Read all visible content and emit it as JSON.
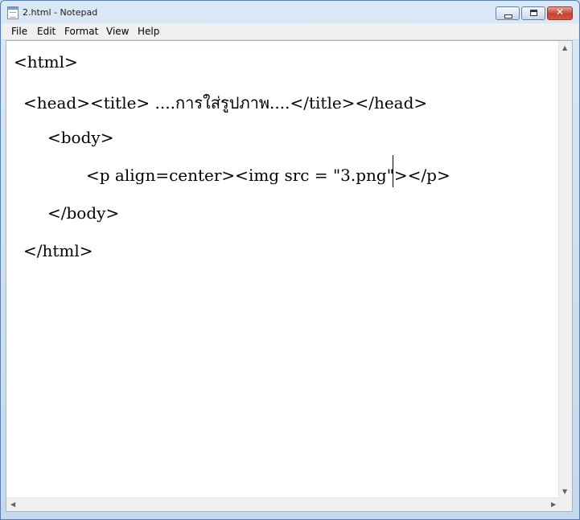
{
  "window": {
    "title": "2.html - Notepad"
  },
  "menu": {
    "items": [
      "File",
      "Edit",
      "Format",
      "View",
      "Help"
    ]
  },
  "editor": {
    "lines": [
      "<html>",
      "<head><title> ....การใส่รูปภาพ....</title></head>",
      "<body>",
      "<p align=center><img src = \"3.png\"></p>",
      "</body>",
      "</html>"
    ]
  },
  "icons": {
    "app": "notepad-icon",
    "minimize": "minimize-icon",
    "maximize": "maximize-icon",
    "close": "close-icon",
    "scroll_up": "scroll-up-arrow-icon",
    "scroll_down": "scroll-down-arrow-icon",
    "scroll_left": "scroll-left-arrow-icon",
    "scroll_right": "scroll-right-arrow-icon"
  }
}
